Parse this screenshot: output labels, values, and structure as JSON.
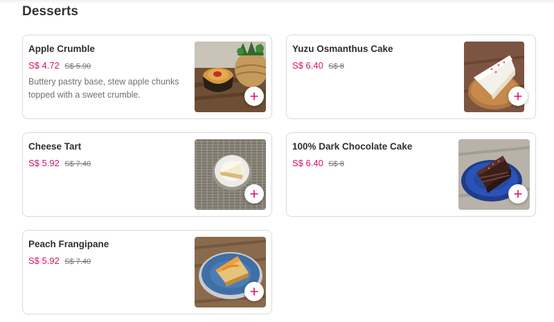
{
  "section": {
    "title": "Desserts"
  },
  "accent_color": "#d70f64",
  "items": [
    {
      "name": "Apple Crumble",
      "price": "S$ 4.72",
      "old_price": "S$ 5.90",
      "description": "Buttery pastry base, stew apple chunks topped with a sweet crumble.",
      "add_icon": "plus-icon"
    },
    {
      "name": "Yuzu Osmanthus Cake",
      "price": "S$ 6.40",
      "old_price": "S$ 8",
      "description": "",
      "add_icon": "plus-icon"
    },
    {
      "name": "Cheese Tart",
      "price": "S$ 5.92",
      "old_price": "S$ 7.40",
      "description": "",
      "add_icon": "plus-icon"
    },
    {
      "name": "100% Dark Chocolate Cake",
      "price": "S$ 6.40",
      "old_price": "S$ 8",
      "description": "",
      "add_icon": "plus-icon"
    },
    {
      "name": "Peach Frangipane",
      "price": "S$ 5.92",
      "old_price": "S$ 7.40",
      "description": "",
      "add_icon": "plus-icon"
    }
  ]
}
